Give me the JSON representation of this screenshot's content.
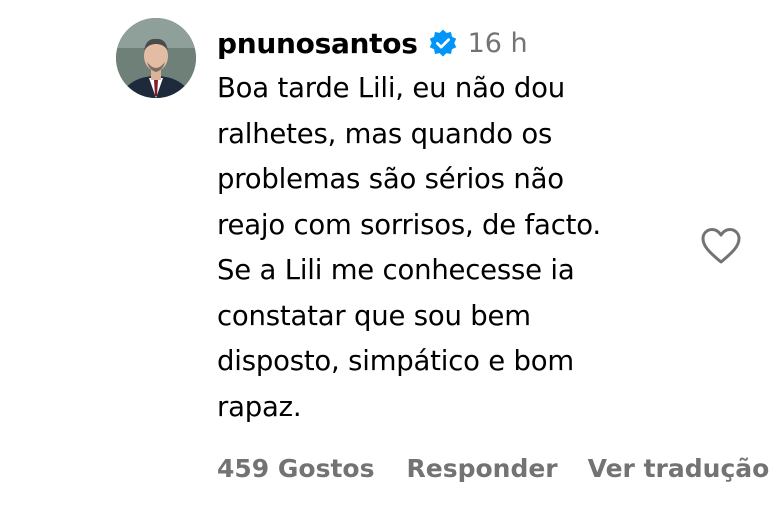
{
  "comment": {
    "username": "pnunosantos",
    "verified": true,
    "verified_icon": "verified-badge-icon",
    "timestamp": "16 h",
    "text": "Boa tarde Lili, eu não dou\nralhetes, mas quando os\nproblemas são sérios não\nreajo com sorrisos, de facto.\nSe a Lili me conhecesse ia\nconstatar que sou bem\ndisposto, simpático e bom\nrapaz.",
    "likes_label": "459 Gostos",
    "reply_label": "Responder",
    "translate_label": "Ver tradução",
    "like_icon": "heart-outline-icon"
  },
  "colors": {
    "verified_blue": "#0095F6",
    "meta_gray": "#737373",
    "text": "#000000"
  }
}
